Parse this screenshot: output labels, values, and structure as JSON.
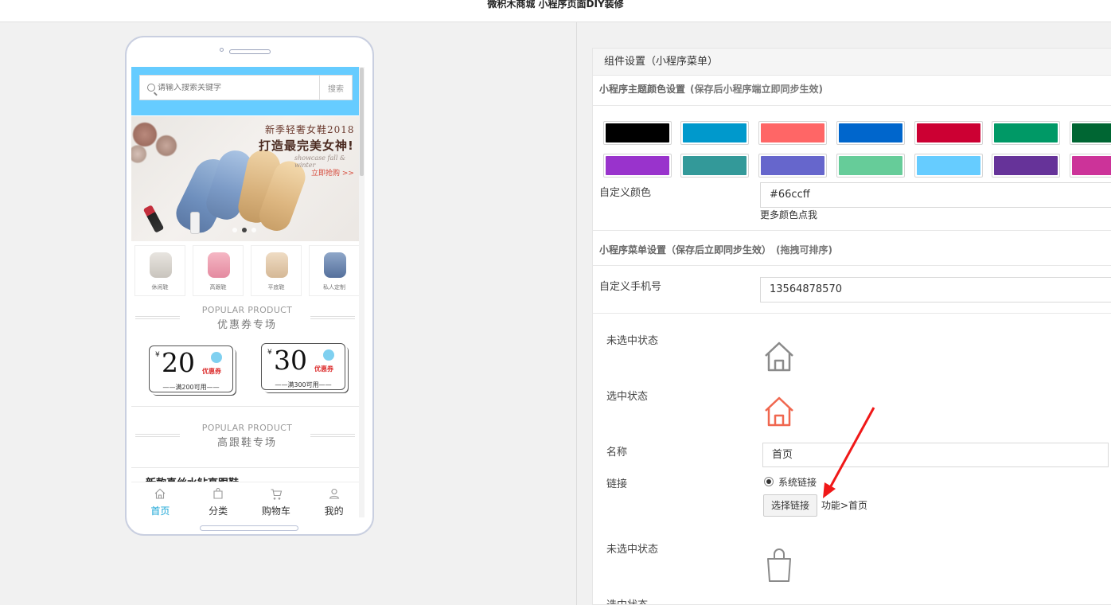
{
  "page_title": "微积木商城 小程序页面DIY装修",
  "phone": {
    "search": {
      "placeholder": "请输入搜索关键字",
      "button": "搜索"
    },
    "banner": {
      "line1": "新季轻奢女鞋2018",
      "line2": "打造最完美女神!",
      "line3": "showcase fall & winter",
      "cta": "立即抢购 >>"
    },
    "categories": [
      {
        "label": "休闲鞋"
      },
      {
        "label": "高跟鞋"
      },
      {
        "label": "平底鞋"
      },
      {
        "label": "私人定制"
      }
    ],
    "section1": {
      "en": "POPULAR PRODUCT",
      "cn": "优惠券专场"
    },
    "coupons": [
      {
        "symbol": "¥",
        "amount": "20",
        "tag": "优惠券",
        "rule": "——满200可用——"
      },
      {
        "symbol": "¥",
        "amount": "30",
        "tag": "优惠券",
        "rule": "——满300可用——"
      }
    ],
    "section2": {
      "en": "POPULAR PRODUCT",
      "cn": "高跟鞋专场"
    },
    "goods_title": "新款真丝水钻高跟鞋",
    "tabbar": [
      {
        "label": "首页",
        "icon": "home-icon",
        "active": true
      },
      {
        "label": "分类",
        "icon": "bag-icon",
        "active": false
      },
      {
        "label": "购物车",
        "icon": "cart-icon",
        "active": false
      },
      {
        "label": "我的",
        "icon": "user-icon",
        "active": false
      }
    ],
    "colors": {
      "search_bg": "#66ccff",
      "tab_active": "#1aa6d6"
    }
  },
  "panel": {
    "header": "组件设置（小程序菜单）",
    "theme": {
      "title": "小程序主题颜色设置",
      "note": "(保存后小程序端立即同步生效)",
      "swatches_row1": [
        "#000000",
        "#0099cc",
        "#ff6666",
        "#0066cc",
        "#cc0033",
        "#009966",
        "#006633"
      ],
      "swatches_row2": [
        "#9933cc",
        "#339999",
        "#6666cc",
        "#66cc99",
        "#66ccff",
        "#663399",
        "#cc3399"
      ],
      "custom_label": "自定义颜色",
      "custom_value": "#66ccff",
      "more_colors": "更多颜色点我"
    },
    "menu": {
      "title": "小程序菜单设置（保存后立即同步生效）",
      "note": "(拖拽可排序)",
      "phone_label": "自定义手机号",
      "phone_value": "13564878570",
      "item1": {
        "unselected_label": "未选中状态",
        "unselected_icon": "home-outline-gray-icon",
        "selected_label": "选中状态",
        "selected_icon": "home-outline-red-icon",
        "name_label": "名称",
        "name_value": "首页",
        "link_label": "链接",
        "radio_label": "系统链接",
        "select_button": "选择链接",
        "link_value": "功能>首页"
      },
      "item2": {
        "unselected_label": "未选中状态",
        "unselected_icon": "bag-outline-icon",
        "selected_label": "选中状态"
      }
    }
  }
}
